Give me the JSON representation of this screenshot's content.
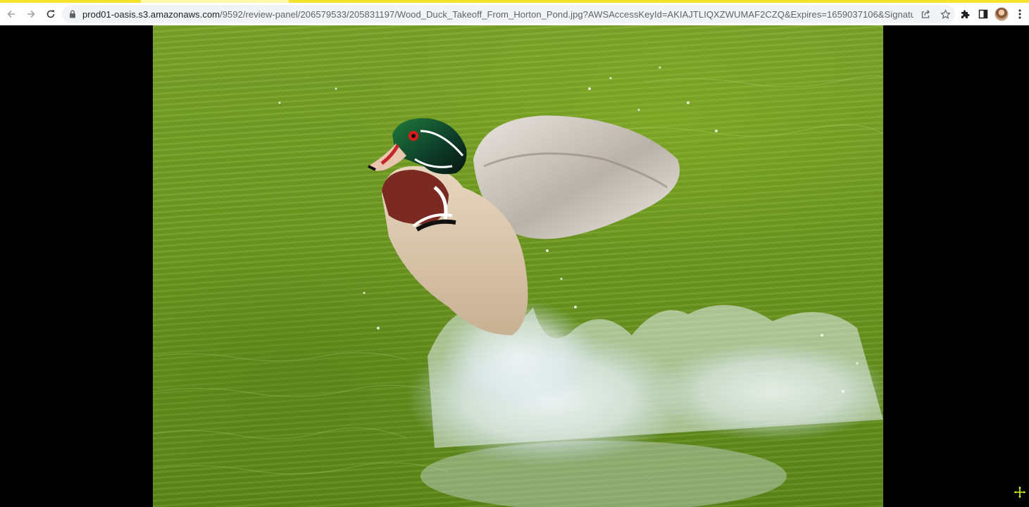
{
  "browser": {
    "url_host": "prod01-oasis.s3.amazonaws.com",
    "url_rest": "/9592/review-panel/206579533/205831197/Wood_Duck_Takeoff_From_Horton_Pond.jpg?AWSAccessKeyId=AKIAJTLIQXZWUMAF2CZQ&Expires=1659037106&Signature=Wckt1LqXzuSZz6eVDjyp...",
    "icons": {
      "back": "arrow-left-icon",
      "forward": "arrow-right-icon",
      "reload": "reload-icon",
      "lock": "lock-icon",
      "share": "share-icon",
      "bookmark": "star-icon",
      "extensions": "puzzle-icon",
      "side_panel": "side-panel-icon",
      "profile": "avatar",
      "menu": "kebab-menu-icon"
    },
    "colors": {
      "toolbar": "#ffffff",
      "omnibox": "#f1f3f4",
      "loading_bar": "#f4e22b"
    }
  },
  "viewer": {
    "background": "#000000",
    "image_subject": "Wood duck taking off from pond",
    "cursor": "move-cursor-icon"
  }
}
